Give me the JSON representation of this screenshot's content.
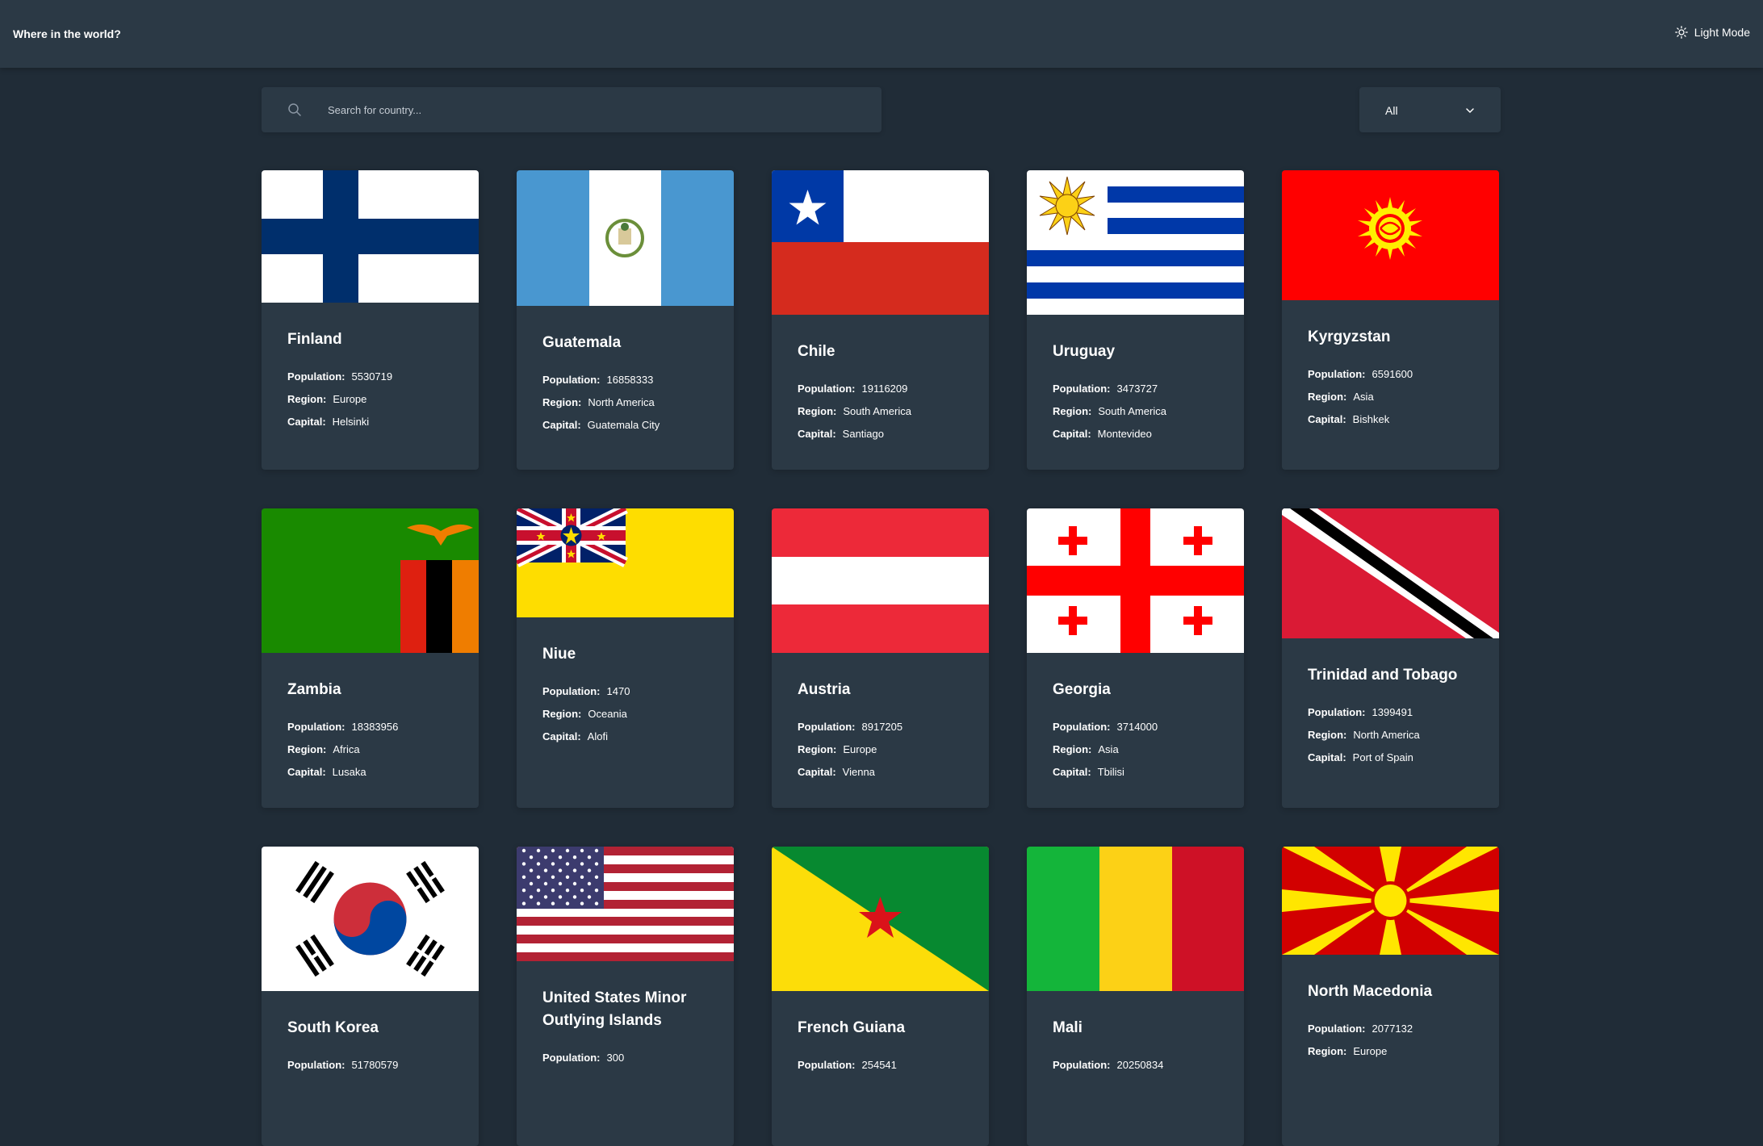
{
  "header": {
    "title": "Where in the world?",
    "theme_label": "Light Mode",
    "theme_icon": "sun-icon"
  },
  "search": {
    "placeholder": "Search for country...",
    "value": ""
  },
  "filter": {
    "selected": "All"
  },
  "labels": {
    "population": "Population:",
    "region": "Region:",
    "capital": "Capital:"
  },
  "colors": {
    "background": "#202c37",
    "surface": "#2b3945",
    "text": "#ffffff"
  },
  "countries": [
    {
      "name": "Finland",
      "population": "5530719",
      "region": "Europe",
      "capital": "Helsinki",
      "flag": "finland-flag"
    },
    {
      "name": "Guatemala",
      "population": "16858333",
      "region": "North America",
      "capital": "Guatemala City",
      "flag": "guatemala-flag"
    },
    {
      "name": "Chile",
      "population": "19116209",
      "region": "South America",
      "capital": "Santiago",
      "flag": "chile-flag"
    },
    {
      "name": "Uruguay",
      "population": "3473727",
      "region": "South America",
      "capital": "Montevideo",
      "flag": "uruguay-flag"
    },
    {
      "name": "Kyrgyzstan",
      "population": "6591600",
      "region": "Asia",
      "capital": "Bishkek",
      "flag": "kyrgyzstan-flag"
    },
    {
      "name": "Zambia",
      "population": "18383956",
      "region": "Africa",
      "capital": "Lusaka",
      "flag": "zambia-flag"
    },
    {
      "name": "Niue",
      "population": "1470",
      "region": "Oceania",
      "capital": "Alofi",
      "flag": "niue-flag"
    },
    {
      "name": "Austria",
      "population": "8917205",
      "region": "Europe",
      "capital": "Vienna",
      "flag": "austria-flag"
    },
    {
      "name": "Georgia",
      "population": "3714000",
      "region": "Asia",
      "capital": "Tbilisi",
      "flag": "georgia-flag"
    },
    {
      "name": "Trinidad and Tobago",
      "population": "1399491",
      "region": "North America",
      "capital": "Port of Spain",
      "flag": "trinidad-and-tobago-flag"
    },
    {
      "name": "South Korea",
      "population": "51780579",
      "flag": "south-korea-flag"
    },
    {
      "name": "United States Minor Outlying Islands",
      "population": "300",
      "flag": "united-states-flag"
    },
    {
      "name": "French Guiana",
      "population": "254541",
      "flag": "french-guiana-flag"
    },
    {
      "name": "Mali",
      "population": "20250834",
      "flag": "mali-flag"
    },
    {
      "name": "North Macedonia",
      "population": "2077132",
      "region": "Europe",
      "flag": "north-macedonia-flag"
    }
  ]
}
